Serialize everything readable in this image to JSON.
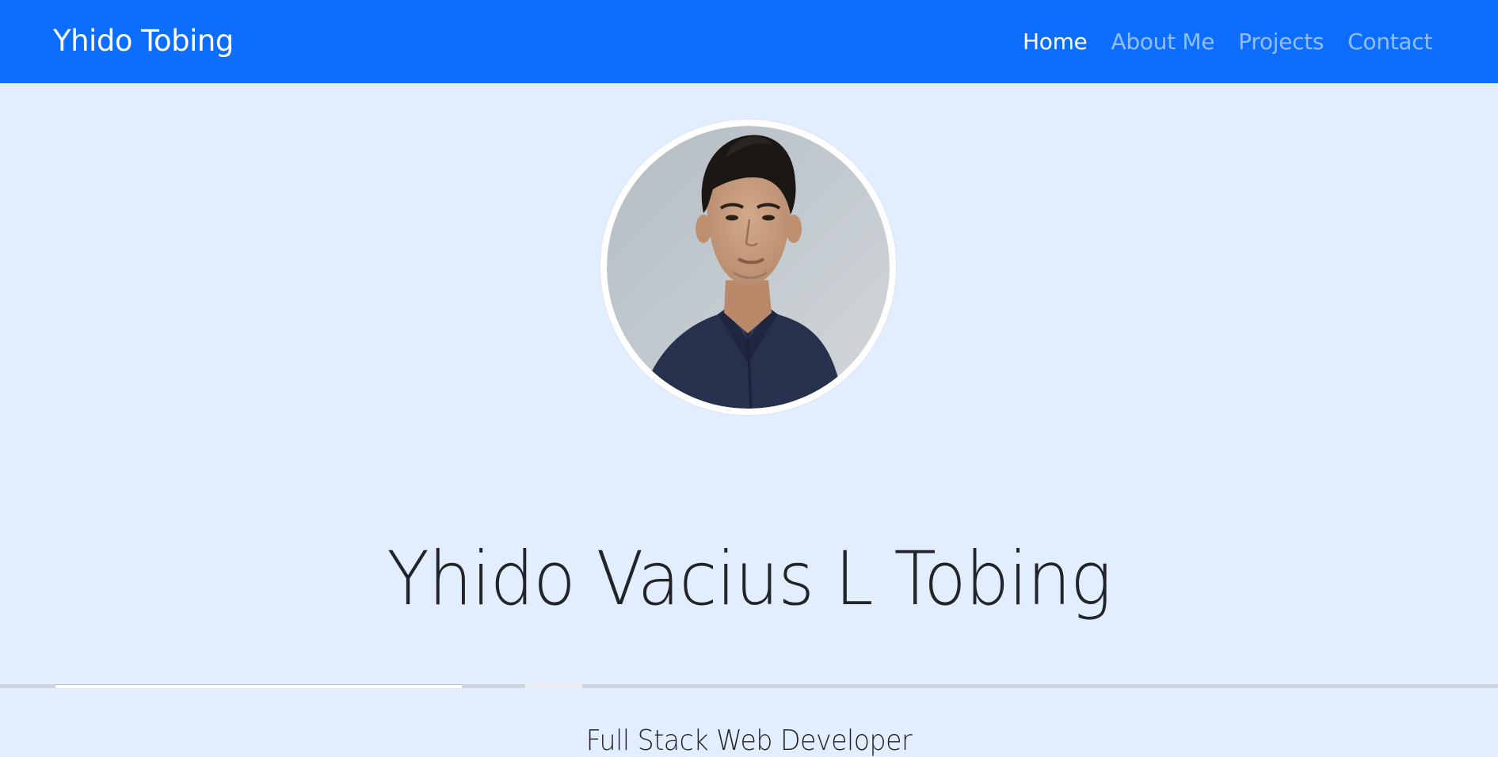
{
  "navbar": {
    "brand": "Yhido Tobing",
    "links": [
      {
        "label": "Home",
        "active": true
      },
      {
        "label": "About Me",
        "active": false
      },
      {
        "label": "Projects",
        "active": false
      },
      {
        "label": "Contact",
        "active": false
      }
    ],
    "bg_color": "#0d6efd"
  },
  "hero": {
    "name": "Yhido Vacius L Tobing",
    "role": "Full Stack Web Developer",
    "bg_color": "#e2edfe"
  }
}
